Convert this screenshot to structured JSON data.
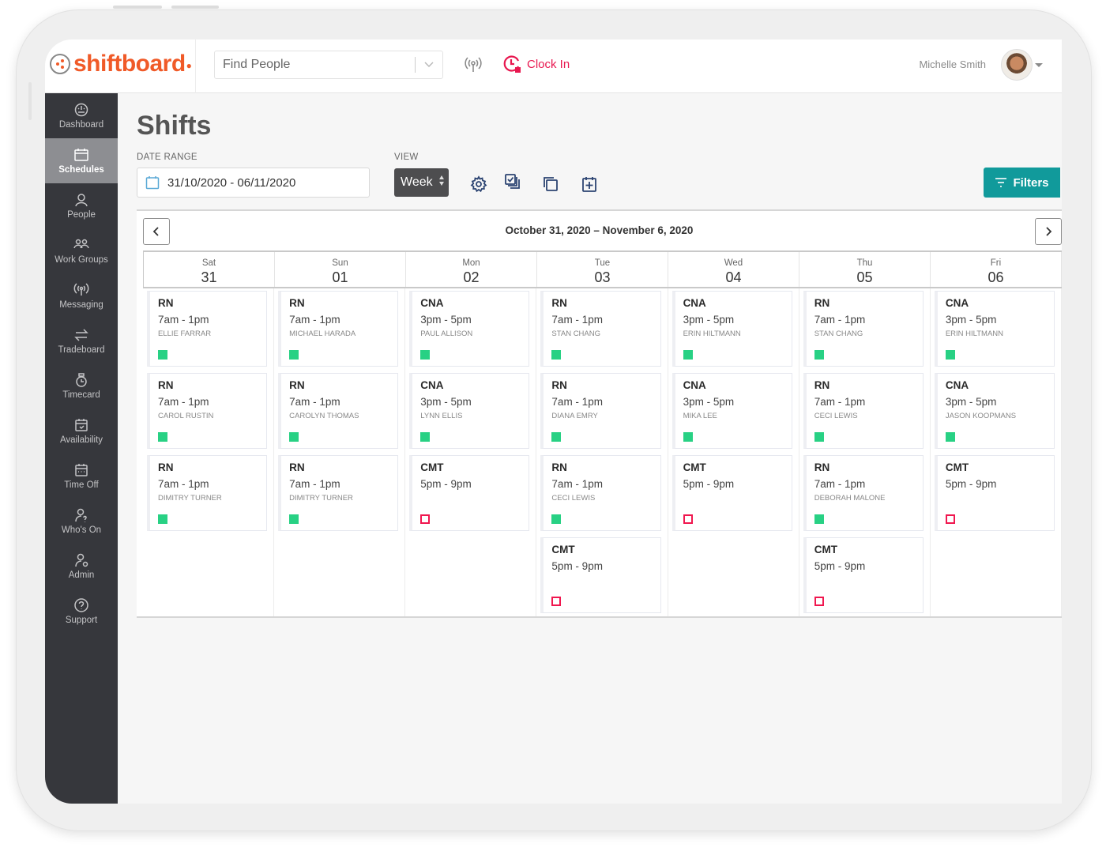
{
  "app": {
    "brand": "shiftboard",
    "brand_color": "#f05a28",
    "accent_color": "#119a9b",
    "clockin_color": "#e8174f"
  },
  "topbar": {
    "search_placeholder": "Find People",
    "broadcast_icon": "broadcast-icon",
    "clockin_label": "Clock In",
    "user_name": "Michelle Smith"
  },
  "sidebar": {
    "items": [
      {
        "label": "Dashboard",
        "icon": "dashboard-icon",
        "active": false
      },
      {
        "label": "Schedules",
        "icon": "calendar-icon",
        "active": true
      },
      {
        "label": "People",
        "icon": "person-icon",
        "active": false
      },
      {
        "label": "Work Groups",
        "icon": "group-icon",
        "active": false
      },
      {
        "label": "Messaging",
        "icon": "broadcast-icon",
        "active": false
      },
      {
        "label": "Tradeboard",
        "icon": "swap-icon",
        "active": false
      },
      {
        "label": "Timecard",
        "icon": "stopwatch-icon",
        "active": false
      },
      {
        "label": "Availability",
        "icon": "calendar-check-icon",
        "active": false
      },
      {
        "label": "Time Off",
        "icon": "calendar-dots-icon",
        "active": false
      },
      {
        "label": "Who's On",
        "icon": "person-question-icon",
        "active": false
      },
      {
        "label": "Admin",
        "icon": "person-gear-icon",
        "active": false
      },
      {
        "label": "Support",
        "icon": "help-icon",
        "active": false
      }
    ]
  },
  "page": {
    "title": "Shifts",
    "date_range_label": "DATE RANGE",
    "date_range_value": "31/10/2020 - 06/11/2020",
    "view_label": "VIEW",
    "view_value": "Week",
    "toolbar_icons": [
      "settings-icon",
      "copy-checked-icon",
      "duplicate-icon",
      "calendar-add-icon"
    ],
    "filters_label": "Filters"
  },
  "calendar": {
    "range_label": "October 31, 2020 – November 6, 2020",
    "days": [
      {
        "name": "Sat",
        "num": "31",
        "shifts": [
          {
            "role": "RN",
            "time": "7am - 1pm",
            "person": "ELLIE FARRAR",
            "status": "filled"
          },
          {
            "role": "RN",
            "time": "7am - 1pm",
            "person": "CAROL RUSTIN",
            "status": "filled"
          },
          {
            "role": "RN",
            "time": "7am - 1pm",
            "person": "DIMITRY TURNER",
            "status": "filled"
          }
        ]
      },
      {
        "name": "Sun",
        "num": "01",
        "shifts": [
          {
            "role": "RN",
            "time": "7am - 1pm",
            "person": "MICHAEL HARADA",
            "status": "filled"
          },
          {
            "role": "RN",
            "time": "7am - 1pm",
            "person": "CAROLYN THOMAS",
            "status": "filled"
          },
          {
            "role": "RN",
            "time": "7am - 1pm",
            "person": "DIMITRY TURNER",
            "status": "filled"
          }
        ]
      },
      {
        "name": "Mon",
        "num": "02",
        "shifts": [
          {
            "role": "CNA",
            "time": "3pm - 5pm",
            "person": "PAUL ALLISON",
            "status": "filled"
          },
          {
            "role": "CNA",
            "time": "3pm - 5pm",
            "person": "LYNN ELLIS",
            "status": "filled"
          },
          {
            "role": "CMT",
            "time": "5pm - 9pm",
            "person": "",
            "status": "open"
          }
        ]
      },
      {
        "name": "Tue",
        "num": "03",
        "shifts": [
          {
            "role": "RN",
            "time": "7am - 1pm",
            "person": "STAN CHANG",
            "status": "filled"
          },
          {
            "role": "RN",
            "time": "7am - 1pm",
            "person": "DIANA EMRY",
            "status": "filled"
          },
          {
            "role": "RN",
            "time": "7am - 1pm",
            "person": "CECI LEWIS",
            "status": "filled"
          },
          {
            "role": "CMT",
            "time": "5pm - 9pm",
            "person": "",
            "status": "open"
          }
        ]
      },
      {
        "name": "Wed",
        "num": "04",
        "shifts": [
          {
            "role": "CNA",
            "time": "3pm - 5pm",
            "person": "ERIN HILTMANN",
            "status": "filled"
          },
          {
            "role": "CNA",
            "time": "3pm - 5pm",
            "person": "MIKA LEE",
            "status": "filled"
          },
          {
            "role": "CMT",
            "time": "5pm - 9pm",
            "person": "",
            "status": "open"
          }
        ]
      },
      {
        "name": "Thu",
        "num": "05",
        "shifts": [
          {
            "role": "RN",
            "time": "7am - 1pm",
            "person": "STAN CHANG",
            "status": "filled"
          },
          {
            "role": "RN",
            "time": "7am - 1pm",
            "person": "CECI LEWIS",
            "status": "filled"
          },
          {
            "role": "RN",
            "time": "7am - 1pm",
            "person": "DEBORAH MALONE",
            "status": "filled"
          },
          {
            "role": "CMT",
            "time": "5pm - 9pm",
            "person": "",
            "status": "open"
          }
        ]
      },
      {
        "name": "Fri",
        "num": "06",
        "shifts": [
          {
            "role": "CNA",
            "time": "3pm - 5pm",
            "person": "ERIN HILTMANN",
            "status": "filled"
          },
          {
            "role": "CNA",
            "time": "3pm - 5pm",
            "person": "JASON KOOPMANS",
            "status": "filled"
          },
          {
            "role": "CMT",
            "time": "5pm - 9pm",
            "person": "",
            "status": "open"
          }
        ]
      }
    ],
    "status_colors": {
      "filled": "#28d184",
      "open": "#f0174f"
    }
  }
}
